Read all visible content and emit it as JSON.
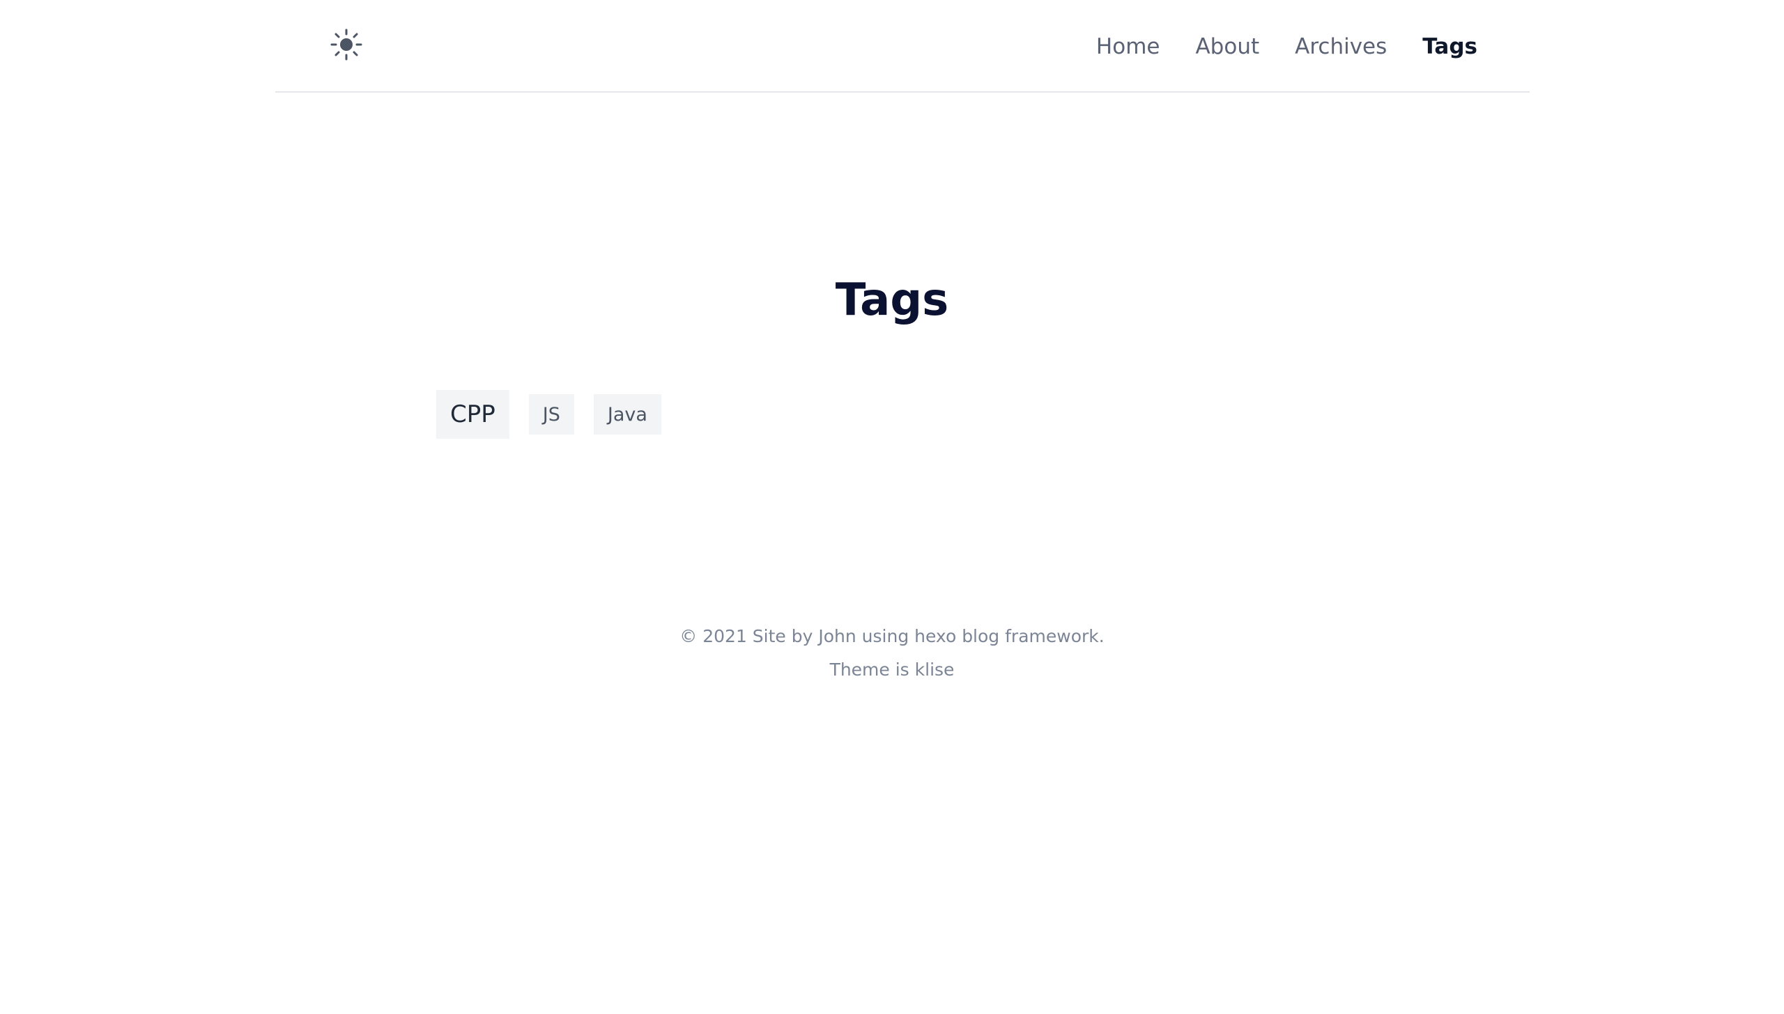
{
  "theme_toggle": {
    "icon": "sun-icon",
    "color": "#4b5563"
  },
  "nav": {
    "items": [
      {
        "label": "Home"
      },
      {
        "label": "About"
      },
      {
        "label": "Archives"
      },
      {
        "label": "Tags",
        "active": true
      }
    ]
  },
  "main": {
    "title": "Tags",
    "tags": [
      {
        "label": "CPP"
      },
      {
        "label": "JS"
      },
      {
        "label": "Java"
      }
    ]
  },
  "footer": {
    "line1": "© 2021 Site by John using hexo blog framework.",
    "line2": "Theme is klise"
  },
  "colors": {
    "title": "#0b1130",
    "nav_text": "#5b6274",
    "nav_active": "#0f172a",
    "tag_bg": "#f3f4f6",
    "footer_text": "#7c8595"
  }
}
